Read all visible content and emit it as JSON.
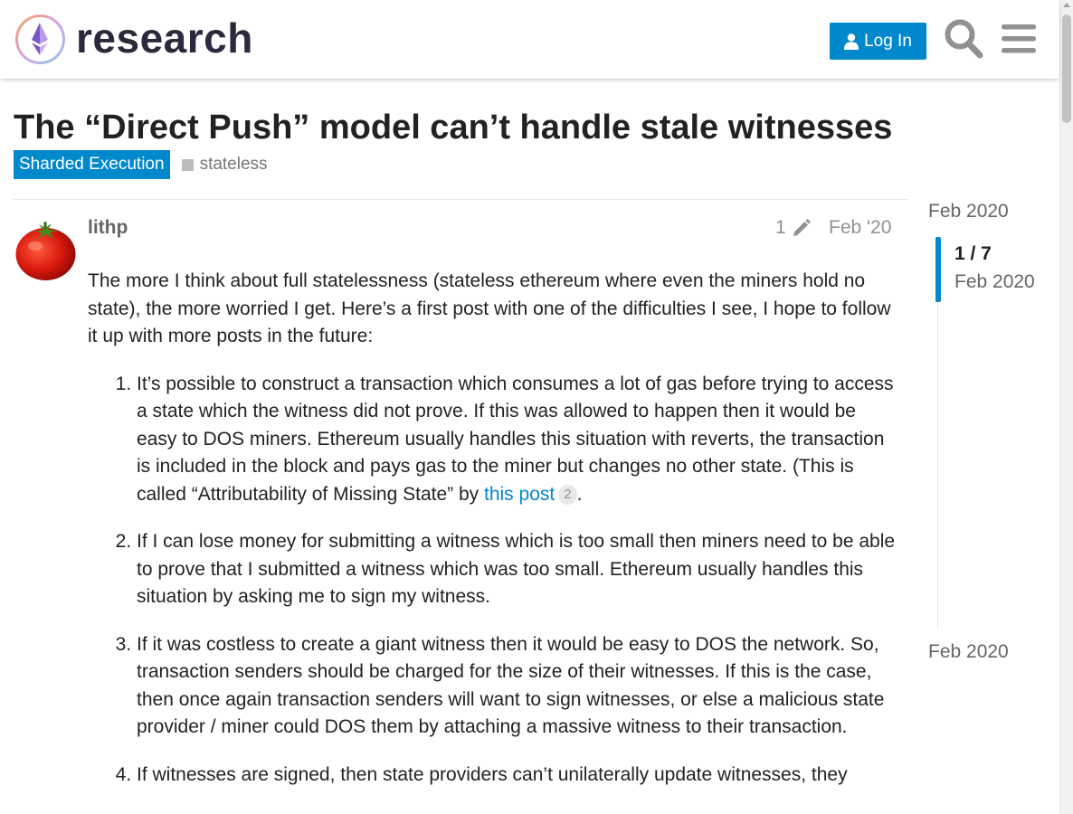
{
  "header": {
    "logo_text": "research",
    "login_label": "Log In",
    "icons": [
      "user-icon",
      "search-icon",
      "hamburger-menu-icon"
    ]
  },
  "topic": {
    "title": "The “Direct Push” model can’t handle stale witnesses",
    "category": "Sharded Execution",
    "tags": [
      "stateless"
    ]
  },
  "post": {
    "username": "lithp",
    "edit_count": "1",
    "date": "Feb '20",
    "intro": "The more I think about full statelessness (stateless ethereum where even the miners hold no state), the more worried I get. Here’s a first post with one of the difficulties I see, I hope to follow it up with more posts in the future:",
    "items": [
      {
        "text": "It’s possible to construct a transaction which consumes a lot of gas before trying to access a state which the witness did not prove. If this was allowed to happen then it would be easy to DOS miners. Ethereum usually handles this situation with reverts, the transaction is included in the block and pays gas to the miner but changes no other state. (This is called “Attributability of Missing State” by ",
        "link_text": "this post",
        "link_clicks": "2",
        "after": "."
      },
      {
        "text": "If I can lose money for submitting a witness which is too small then miners need to be able to prove that I submitted a witness which was too small. Ethereum usually handles this situation by asking me to sign my witness."
      },
      {
        "text": "If it was costless to create a giant witness then it would be easy to DOS the network. So, transaction senders should be charged for the size of their witnesses. If this is the case, then once again transaction senders will want to sign witnesses, or else a malicious state provider / miner could DOS them by attaching a massive witness to their transaction."
      },
      {
        "text": "If witnesses are signed, then state providers can’t unilaterally update witnesses, they"
      }
    ]
  },
  "timeline": {
    "start_label": "Feb 2020",
    "position": "1 / 7",
    "current_date": "Feb 2020",
    "end_label": "Feb 2020"
  },
  "colors": {
    "accent": "#0088cc",
    "text": "#222222",
    "muted": "#919191"
  }
}
